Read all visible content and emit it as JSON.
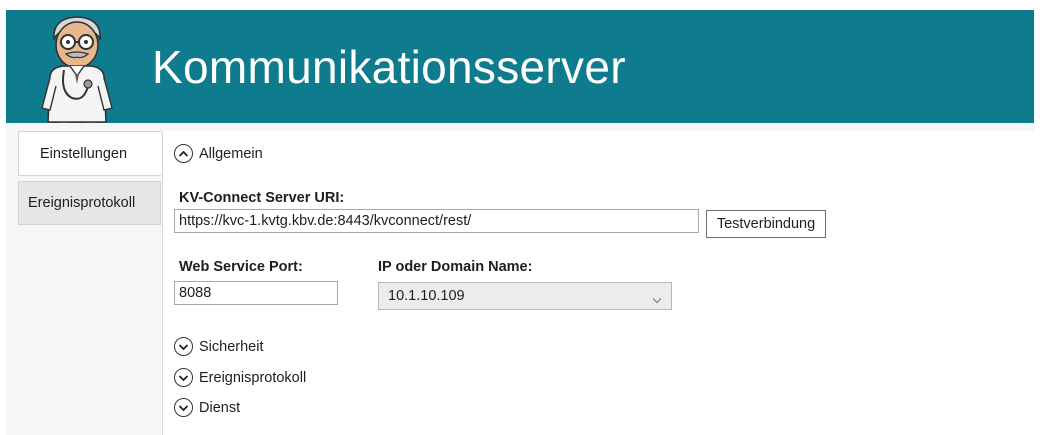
{
  "header": {
    "title": "Kommunikationsserver"
  },
  "tabs": [
    {
      "label": "Einstellungen",
      "active": true
    },
    {
      "label": "Ereignisprotokoll",
      "active": false
    }
  ],
  "sections": {
    "allgemein": {
      "label": "Allgemein",
      "expanded": true,
      "icon": "chevron-up-icon"
    },
    "sicherheit": {
      "label": "Sicherheit",
      "expanded": false,
      "icon": "chevron-down-icon"
    },
    "ereignisprotokoll": {
      "label": "Ereignisprotokoll",
      "expanded": false,
      "icon": "chevron-down-icon"
    },
    "dienst": {
      "label": "Dienst",
      "expanded": false,
      "icon": "chevron-down-icon"
    }
  },
  "form": {
    "server_uri_label": "KV-Connect Server URI:",
    "server_uri_value": "https://kvc-1.kvtg.kbv.de:8443/kvconnect/rest/",
    "test_button": "Testverbindung",
    "port_label": "Web Service Port:",
    "port_value": "8088",
    "domain_label": "IP oder Domain Name:",
    "domain_value": "10.1.10.109"
  },
  "colors": {
    "header_bg": "#0f7b8e"
  }
}
